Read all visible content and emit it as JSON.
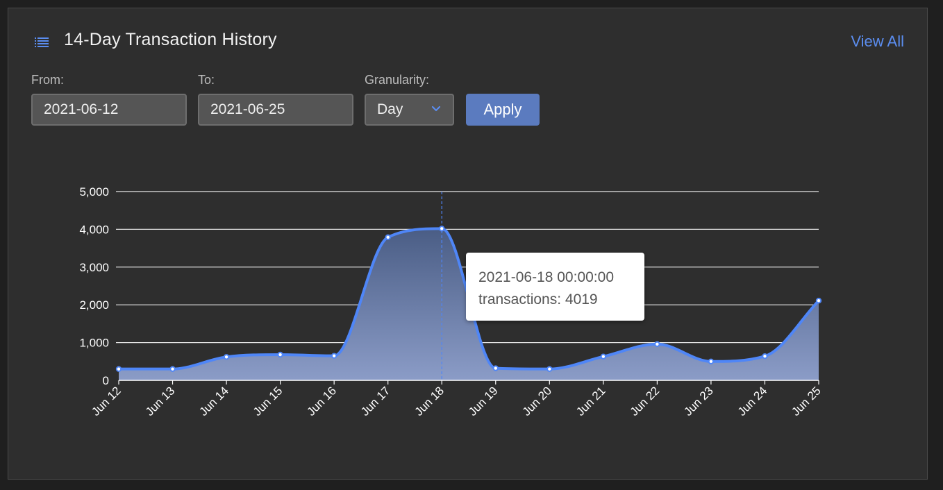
{
  "header": {
    "title": "14-Day Transaction History",
    "view_all": "View All",
    "icon": "list-icon"
  },
  "filters": {
    "from_label": "From:",
    "from_value": "2021-06-12",
    "to_label": "To:",
    "to_value": "2021-06-25",
    "granularity_label": "Granularity:",
    "granularity_value": "Day",
    "apply_label": "Apply"
  },
  "tooltip": {
    "line1": "2021-06-18 00:00:00",
    "line2": "transactions: 4019"
  },
  "colors": {
    "line": "#4f86f7",
    "accent": "#5b8def",
    "button": "#5b7bbf"
  },
  "chart_data": {
    "type": "area",
    "categories": [
      "Jun 12",
      "Jun 13",
      "Jun 14",
      "Jun 15",
      "Jun 16",
      "Jun 17",
      "Jun 18",
      "Jun 19",
      "Jun 20",
      "Jun 21",
      "Jun 22",
      "Jun 23",
      "Jun 24",
      "Jun 25"
    ],
    "series": [
      {
        "name": "transactions",
        "values": [
          300,
          300,
          620,
          680,
          650,
          3790,
          4019,
          320,
          300,
          630,
          960,
          500,
          640,
          2110
        ]
      }
    ],
    "ylim": [
      0,
      5000
    ],
    "yticks": [
      "0",
      "1,000",
      "2,000",
      "3,000",
      "4,000",
      "5,000"
    ],
    "grid": true,
    "highlighted_category": "Jun 18"
  }
}
